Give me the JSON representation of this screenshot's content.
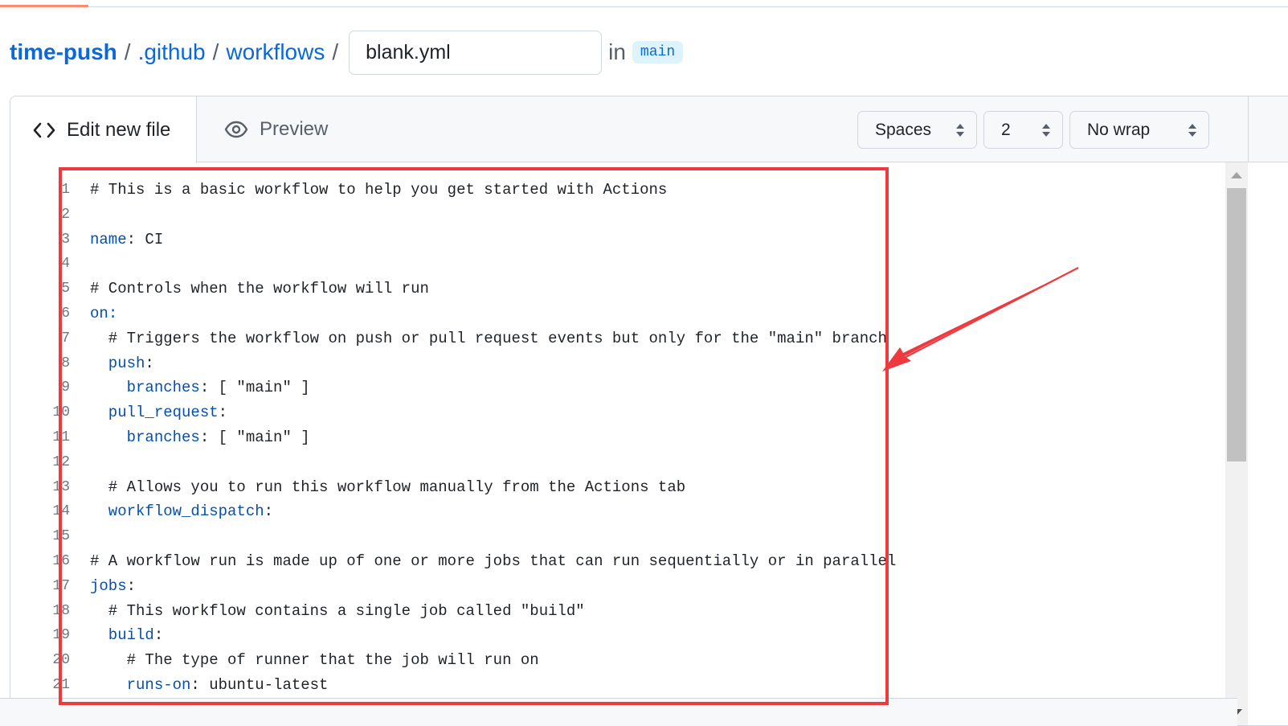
{
  "breadcrumb": {
    "repo": "time-push",
    "folder1": ".github",
    "folder2": "workflows",
    "separator": "/",
    "filename_value": "blank.yml",
    "in_label": "in",
    "branch": "main"
  },
  "tabs": {
    "edit_label": "Edit new file",
    "preview_label": "Preview"
  },
  "editor_options": {
    "indent_mode": "Spaces",
    "indent_size": "2",
    "wrap_mode": "No wrap"
  },
  "line_numbers": [
    "1",
    "2",
    "3",
    "4",
    "5",
    "6",
    "7",
    "8",
    "9",
    "10",
    "11",
    "12",
    "13",
    "14",
    "15",
    "16",
    "17",
    "18",
    "19",
    "20",
    "21"
  ],
  "code_lines": [
    [
      {
        "t": "# This is a basic workflow to help you get started with Actions",
        "c": "comment"
      }
    ],
    [],
    [
      {
        "t": "name",
        "c": "key"
      },
      {
        "t": ": CI",
        "c": "plain"
      }
    ],
    [],
    [
      {
        "t": "# Controls when the workflow will run",
        "c": "comment"
      }
    ],
    [
      {
        "t": "on",
        "c": "key"
      },
      {
        "t": ":",
        "c": "key"
      }
    ],
    [
      {
        "t": "  # Triggers the workflow on push or pull request events but only for the \"main\" branch",
        "c": "comment"
      }
    ],
    [
      {
        "t": "  push",
        "c": "key"
      },
      {
        "t": ":",
        "c": "plain"
      }
    ],
    [
      {
        "t": "    branches",
        "c": "key"
      },
      {
        "t": ": [ \"main\" ]",
        "c": "plain"
      }
    ],
    [
      {
        "t": "  pull_request",
        "c": "key"
      },
      {
        "t": ":",
        "c": "plain"
      }
    ],
    [
      {
        "t": "    branches",
        "c": "key"
      },
      {
        "t": ": [ \"main\" ]",
        "c": "plain"
      }
    ],
    [],
    [
      {
        "t": "  # Allows you to run this workflow manually from the Actions tab",
        "c": "comment"
      }
    ],
    [
      {
        "t": "  workflow_dispatch",
        "c": "key"
      },
      {
        "t": ":",
        "c": "plain"
      }
    ],
    [],
    [
      {
        "t": "# A workflow run is made up of one or more jobs that can run sequentially or in parallel",
        "c": "comment"
      }
    ],
    [
      {
        "t": "jobs",
        "c": "key"
      },
      {
        "t": ":",
        "c": "plain"
      }
    ],
    [
      {
        "t": "  # This workflow contains a single job called \"build\"",
        "c": "comment"
      }
    ],
    [
      {
        "t": "  build",
        "c": "key"
      },
      {
        "t": ":",
        "c": "plain"
      }
    ],
    [
      {
        "t": "    # The type of runner that the job will run on",
        "c": "comment"
      }
    ],
    [
      {
        "t": "    runs-on",
        "c": "key"
      },
      {
        "t": ": ubuntu-latest",
        "c": "plain"
      }
    ]
  ],
  "colors": {
    "link": "#0969da",
    "yaml_key": "#0550ae",
    "annotation": "#ee3a3f",
    "tab_accent": "#fd8c73"
  }
}
